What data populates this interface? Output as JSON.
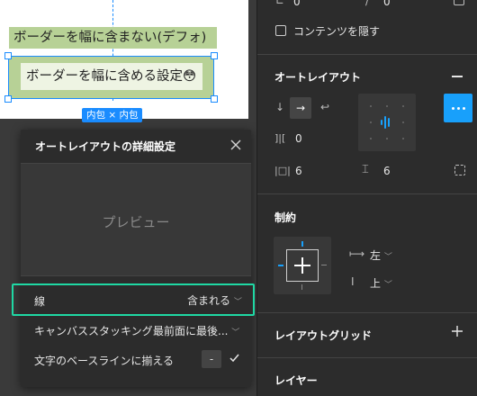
{
  "canvas": {
    "frame1_text": "ボーダーを幅に含まない(デフォ)",
    "frame2_text": "ボーダーを幅に含める設定😳",
    "size_badge": "内包 × 内包"
  },
  "popup": {
    "title": "オートレイアウトの詳細設定",
    "preview_label": "プレビュー",
    "rows": [
      {
        "label": "線",
        "value": "含まれる"
      },
      {
        "label": "キャンバススタッキング",
        "value": "最前面に最後..."
      },
      {
        "label": "文字のベースラインに揃える",
        "value": "-"
      }
    ]
  },
  "panel": {
    "top_values": {
      "a": "0",
      "b": "0"
    },
    "hide_content_label": "コンテンツを隠す",
    "auto_layout": {
      "title": "オートレイアウト",
      "spacing": "0",
      "padding_horizontal": "6",
      "padding_vertical": "6"
    },
    "constraints": {
      "title": "制約",
      "horizontal": "左",
      "vertical": "上"
    },
    "layout_grid_title": "レイアウトグリッド",
    "layer_title": "レイヤー"
  },
  "colors": {
    "accent": "#18a0fb",
    "highlight": "#1fd8a4",
    "frame_fill": "#b7d196"
  }
}
